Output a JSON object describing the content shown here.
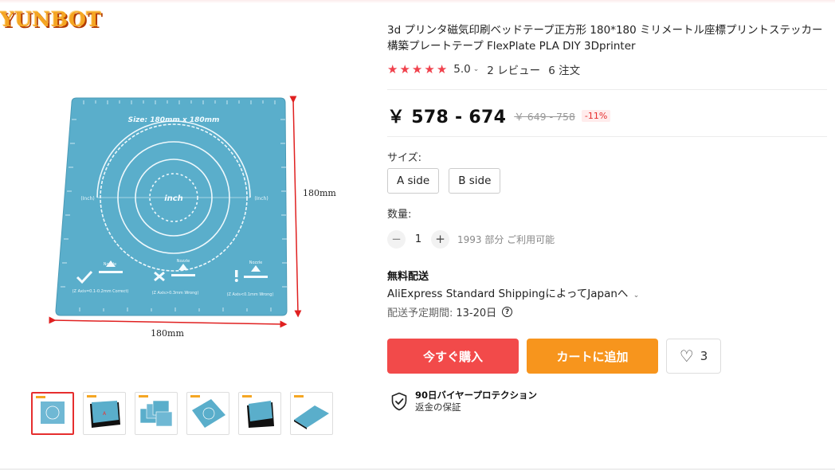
{
  "brand": {
    "logo_text": "YUNBOT"
  },
  "gallery": {
    "main_image": {
      "size_label": "Size: 180mm x 180mm",
      "center_label": "inch",
      "left_label": "(Inch)",
      "right_label": "(Inch)",
      "dim_right": "180mm",
      "dim_bottom": "180mm",
      "nozzle_label": "Nozzle",
      "hint_correct": "(Z Axis=0.1-0.2mm Correct)",
      "hint_wrong_high": "(Z Axis>0.3mm Wrong)",
      "hint_wrong_low": "(Z Axis<0.1mm Wrong)"
    },
    "thumbnails": [
      "thumb-1",
      "thumb-2",
      "thumb-3",
      "thumb-4",
      "thumb-5",
      "thumb-6"
    ],
    "active_thumb": 0
  },
  "product": {
    "title": "3d プリンタ磁気印刷ベッドテープ正方形 180*180 ミリメートル座標プリントステッカー構築プレートテープ FlexPlate PLA DIY 3Dprinter",
    "rating": "5.0",
    "stars": 5,
    "reviews": "2 レビュー",
    "orders": "6 注文",
    "price": "￥ 578 - 674",
    "original_price": "￥ 649 - 758",
    "discount": "-11%",
    "size_label": "サイズ:",
    "sku_options": [
      "A side",
      "B side"
    ],
    "qty_label": "数量:",
    "qty_minus": "−",
    "qty_value": "1",
    "qty_plus": "+",
    "stock": "1993 部分 ご利用可能",
    "shipping_title": "無料配送",
    "shipping_method": "AliExpress Standard ShippingによってJapanへ",
    "delivery_label": "配送予定期間:",
    "delivery_value": "13-20日",
    "buy_now": "今すぐ購入",
    "add_to_cart": "カートに追加",
    "wishlist_count": "3",
    "protection_title": "90日バイヤープロテクション",
    "protection_sub": "返金の保証"
  },
  "colors": {
    "accent_red": "#f24a4a",
    "accent_orange": "#f7951d",
    "star_red": "#f0414c",
    "sheet_blue": "#5aaecb"
  },
  "icons": {
    "rating_star": "star-icon",
    "dropdown": "chevron-down-icon",
    "help": "question-circle-icon",
    "wishlist": "heart-icon",
    "protection": "shield-check-icon"
  }
}
